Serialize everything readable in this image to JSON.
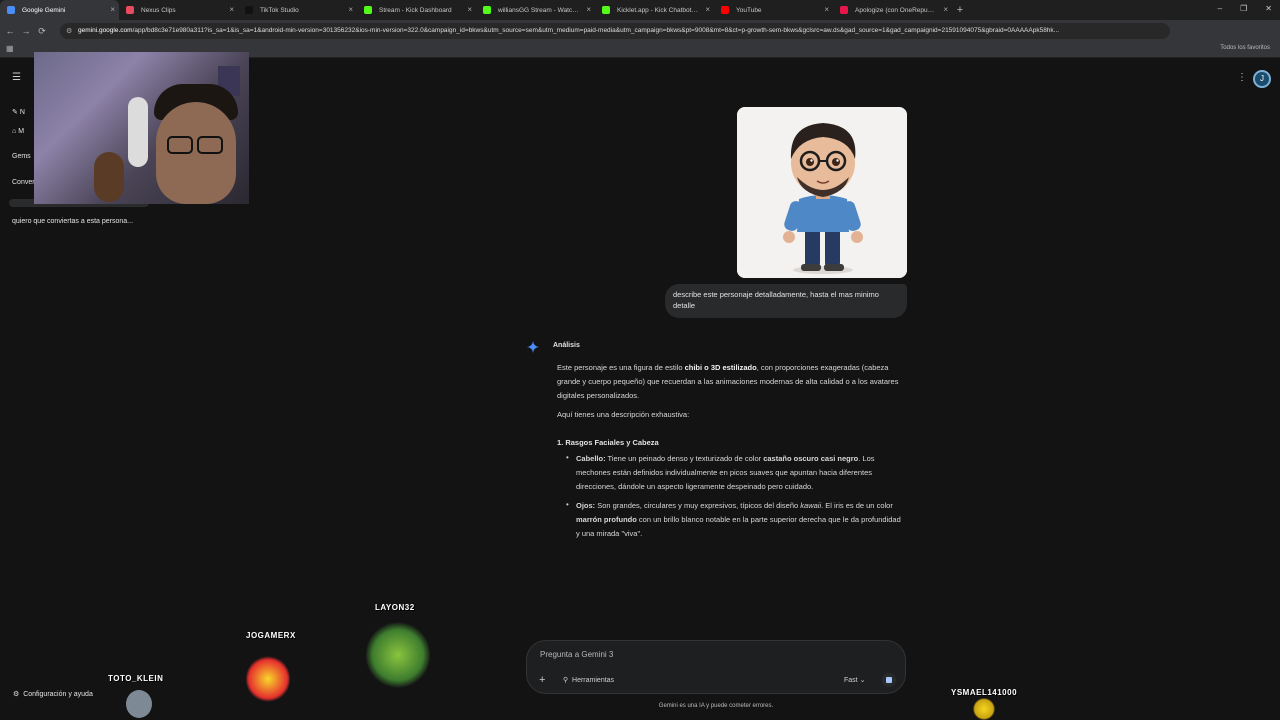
{
  "browser": {
    "tabs": [
      {
        "title": "Google Gemini",
        "color": "#4a8df8",
        "active": true
      },
      {
        "title": "Nexus Clips",
        "color": "#e84a5f",
        "active": false
      },
      {
        "title": "TikTok Studio",
        "color": "#111111",
        "active": false
      },
      {
        "title": "Stream - Kick Dashboard",
        "color": "#53fc18",
        "active": false
      },
      {
        "title": "williansGG Stream - Watch Live",
        "color": "#53fc18",
        "active": false
      },
      {
        "title": "Kicklet.app - Kick Chatbot and",
        "color": "#53fc18",
        "active": false
      },
      {
        "title": "YouTube",
        "color": "#ff0000",
        "active": false
      },
      {
        "title": "Apologize (con OneRepublic",
        "color": "#e8174a",
        "active": false
      }
    ],
    "new_tab": "+",
    "url_host": "gemini.google.com",
    "url_path": "/app/bd8c3e71e980a311?is_sa=1&is_sa=1&android-min-version=301356232&ios-min-version=322.0&campaign_id=bkws&utm_source=sem&utm_medium=paid-media&utm_campaign=bkws&pt=9008&mt=8&ct=p-growth-sem-bkws&gclsrc=aw.ds&gad_source=1&gad_campaignid=21591094075&gbraid=0AAAAApk58hk...",
    "bookmarks_all": "Todos los favoritos"
  },
  "sidebar": {
    "items": [
      "N",
      "M",
      "Gems",
      "Conver"
    ],
    "recent_chat": "quiero que conviertas a esta persona...",
    "settings": "Configuración y ayuda"
  },
  "header": {
    "avatar_letter": "J"
  },
  "user_message": "describe este personaje detalladamente, hasta el mas minimo detalle",
  "response": {
    "label": "Análisis",
    "intro_pre": "Este personaje es una figura de estilo ",
    "intro_bold": "chibi o 3D estilizado",
    "intro_post": ", con proporciones exageradas (cabeza grande y cuerpo pequeño) que recuerdan a las animaciones modernas de alta calidad o a los avatares digitales personalizados.",
    "lead": "Aquí tienes una descripción exhaustiva:",
    "section1": "1. Rasgos Faciales y Cabeza",
    "hair_label": "Cabello:",
    "hair_text_a": " Tiene un peinado denso y texturizado de color ",
    "hair_bold": "castaño oscuro casi negro",
    "hair_text_b": ". Los mechones están definidos individualmente en picos suaves que apuntan hacia diferentes direcciones, dándole un aspecto ligeramente despeinado pero cuidado.",
    "eyes_label": "Ojos:",
    "eyes_text_a": " Son grandes, circulares y muy expresivos, típicos del diseño ",
    "eyes_italic": "kawaii",
    "eyes_text_b": ". El iris es de un color ",
    "eyes_bold": "marrón profundo",
    "eyes_text_c": " con un brillo blanco notable en la parte superior derecha que le da profundidad y una mirada \"viva\"."
  },
  "composer": {
    "placeholder": "Pregunta a Gemini 3",
    "tools": "Herramientas",
    "mode": "Fast"
  },
  "disclaimer": "Gemini es una IA y puede cometer errores.",
  "overlay_nicks": [
    "TOTO_KLEIN",
    "JOGAMERX",
    "LAYON32",
    "YSMAEL141000"
  ]
}
